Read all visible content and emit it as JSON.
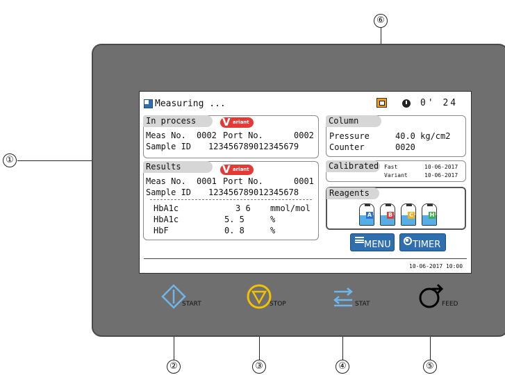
{
  "callouts": [
    "①",
    "②",
    "③",
    "④",
    "⑤",
    "⑥"
  ],
  "header": {
    "status": "Measuring ...",
    "timer": "0' 24"
  },
  "in_process": {
    "title": "In process",
    "badge": "ariant",
    "meas_label": "Meas No.",
    "meas_no": "0002",
    "port_label": "Port No.",
    "port_no": "0002",
    "sample_label": "Sample ID",
    "sample_id": "123456789012345679"
  },
  "results": {
    "title": "Results",
    "badge": "ariant",
    "meas_label": "Meas No.",
    "meas_no": "0001",
    "port_label": "Port No.",
    "port_no": "0001",
    "sample_label": "Sample ID",
    "sample_id": "123456789012345678",
    "rows": [
      {
        "name": "HbA1c",
        "value": "3 6",
        "unit": "mmol/mol"
      },
      {
        "name": "HbA1c",
        "value": "5. 5",
        "unit": "%"
      },
      {
        "name": "HbF",
        "value": "0. 8",
        "unit": "%"
      }
    ]
  },
  "column": {
    "title": "Column",
    "pressure_label": "Pressure",
    "pressure_value": "40.0 kg/cm2",
    "counter_label": "Counter",
    "counter_value": "0020"
  },
  "calibrated": {
    "title": "Calibrated",
    "fast_label": "Fast",
    "fast_date": "10-06-2017",
    "variant_label": "Variant",
    "variant_date": "10-06-2017"
  },
  "reagents": {
    "title": "Reagents",
    "bottles": [
      "A",
      "B",
      "C",
      "H"
    ],
    "bottle_colors": [
      "#2d6fd1",
      "#e53935",
      "#f2b21b",
      "#3fae49"
    ]
  },
  "buttons": {
    "menu": "MENU",
    "timer": "TIMER"
  },
  "footer": {
    "datetime": "10-06-2017 10:00"
  },
  "hardware": {
    "start": "START",
    "stop": "STOP",
    "stat": "STAT",
    "feed": "FEED"
  }
}
